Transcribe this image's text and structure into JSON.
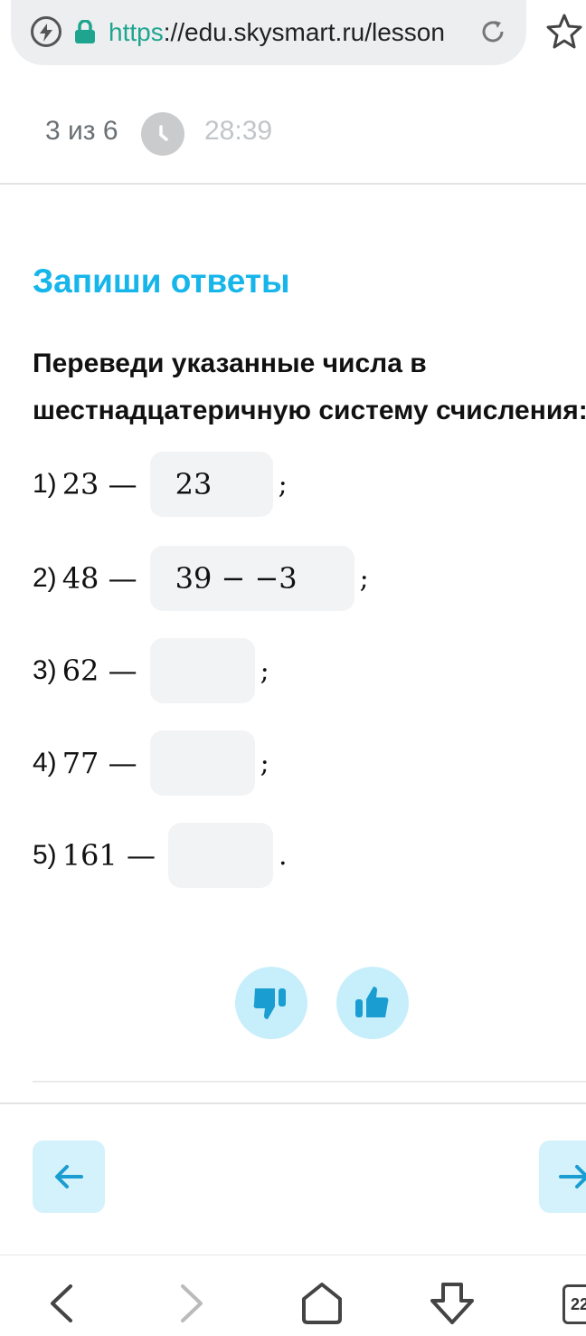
{
  "browser": {
    "url_scheme": "https",
    "url_rest": "://edu.skysmart.ru/lesson",
    "tabs_count": "22"
  },
  "progress": {
    "text": "3 из 6",
    "timer": "28:39"
  },
  "task": {
    "heading": "Запиши ответы",
    "instruction_line1": "Переведи указанные числа в",
    "instruction_line2": "шестнадцатеричную систему счисления:",
    "items": [
      {
        "num": "1)",
        "expr": "23 —",
        "answer": "23",
        "punct": ";"
      },
      {
        "num": "2)",
        "expr": "48 —",
        "answer": "39 − −3",
        "punct": ";"
      },
      {
        "num": "3)",
        "expr": "62 —",
        "answer": "",
        "punct": ";"
      },
      {
        "num": "4)",
        "expr": "77 —",
        "answer": "",
        "punct": ";"
      },
      {
        "num": "5)",
        "expr": "161 —",
        "answer": "",
        "punct": "."
      }
    ]
  },
  "colors": {
    "accent": "#16b5ea",
    "button_bg": "#c7eefb",
    "icon": "#1a9dd1"
  }
}
